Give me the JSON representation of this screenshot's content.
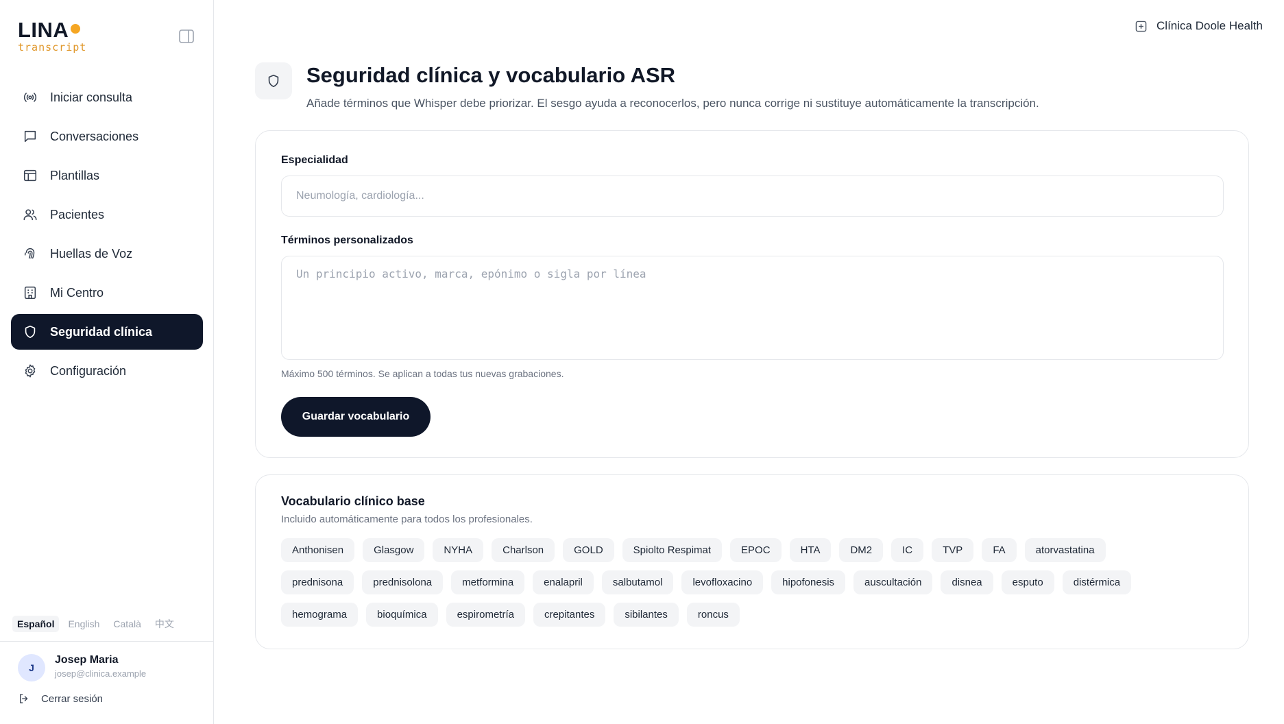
{
  "app": {
    "logo_text": "LINA",
    "logo_sub": "transcript"
  },
  "sidebar": {
    "items": [
      {
        "label": "Iniciar consulta",
        "icon": "broadcast-icon"
      },
      {
        "label": "Conversaciones",
        "icon": "message-square-icon"
      },
      {
        "label": "Plantillas",
        "icon": "layout-template-icon"
      },
      {
        "label": "Pacientes",
        "icon": "users-icon"
      },
      {
        "label": "Huellas de Voz",
        "icon": "fingerprint-icon"
      },
      {
        "label": "Mi Centro",
        "icon": "building-icon"
      },
      {
        "label": "Seguridad clínica",
        "icon": "shield-icon",
        "active": true
      },
      {
        "label": "Configuración",
        "icon": "gear-icon"
      }
    ],
    "languages": [
      "Español",
      "English",
      "Català",
      "中文"
    ],
    "selected_language": "Español",
    "user": {
      "initial": "J",
      "name": "Josep Maria",
      "email": "josep@clinica.example"
    },
    "logout_label": "Cerrar sesión"
  },
  "header": {
    "clinic_name": "Clínica Doole Health",
    "title": "Seguridad clínica y vocabulario ASR",
    "subtitle": "Añade términos que Whisper debe priorizar. El sesgo ayuda a reconocerlos, pero nunca corrige ni sustituye automáticamente la transcripción."
  },
  "form": {
    "specialty_label": "Especialidad",
    "specialty_value": "",
    "specialty_placeholder": "Neumología, cardiología...",
    "terms_label": "Términos personalizados",
    "terms_value": "",
    "terms_placeholder": "Un principio activo, marca, epónimo o sigla por línea",
    "hint": "Máximo 500 términos. Se aplican a todas tus nuevas grabaciones.",
    "save_label": "Guardar vocabulario"
  },
  "base_vocab": {
    "title": "Vocabulario clínico base",
    "subtitle": "Incluido automáticamente para todos los profesionales.",
    "terms": [
      "Anthonisen",
      "Glasgow",
      "NYHA",
      "Charlson",
      "GOLD",
      "Spiolto Respimat",
      "EPOC",
      "HTA",
      "DM2",
      "IC",
      "TVP",
      "FA",
      "atorvastatina",
      "prednisona",
      "prednisolona",
      "metformina",
      "enalapril",
      "salbutamol",
      "levofloxacino",
      "hipofonesis",
      "auscultación",
      "disnea",
      "esputo",
      "distérmica",
      "hemograma",
      "bioquímica",
      "espirometría",
      "crepitantes",
      "sibilantes",
      "roncus"
    ]
  },
  "colors": {
    "accent_dark": "#0f172a",
    "logo_dot": "#f5a623",
    "border": "#e5e7eb",
    "tag_bg": "#f3f4f6"
  }
}
